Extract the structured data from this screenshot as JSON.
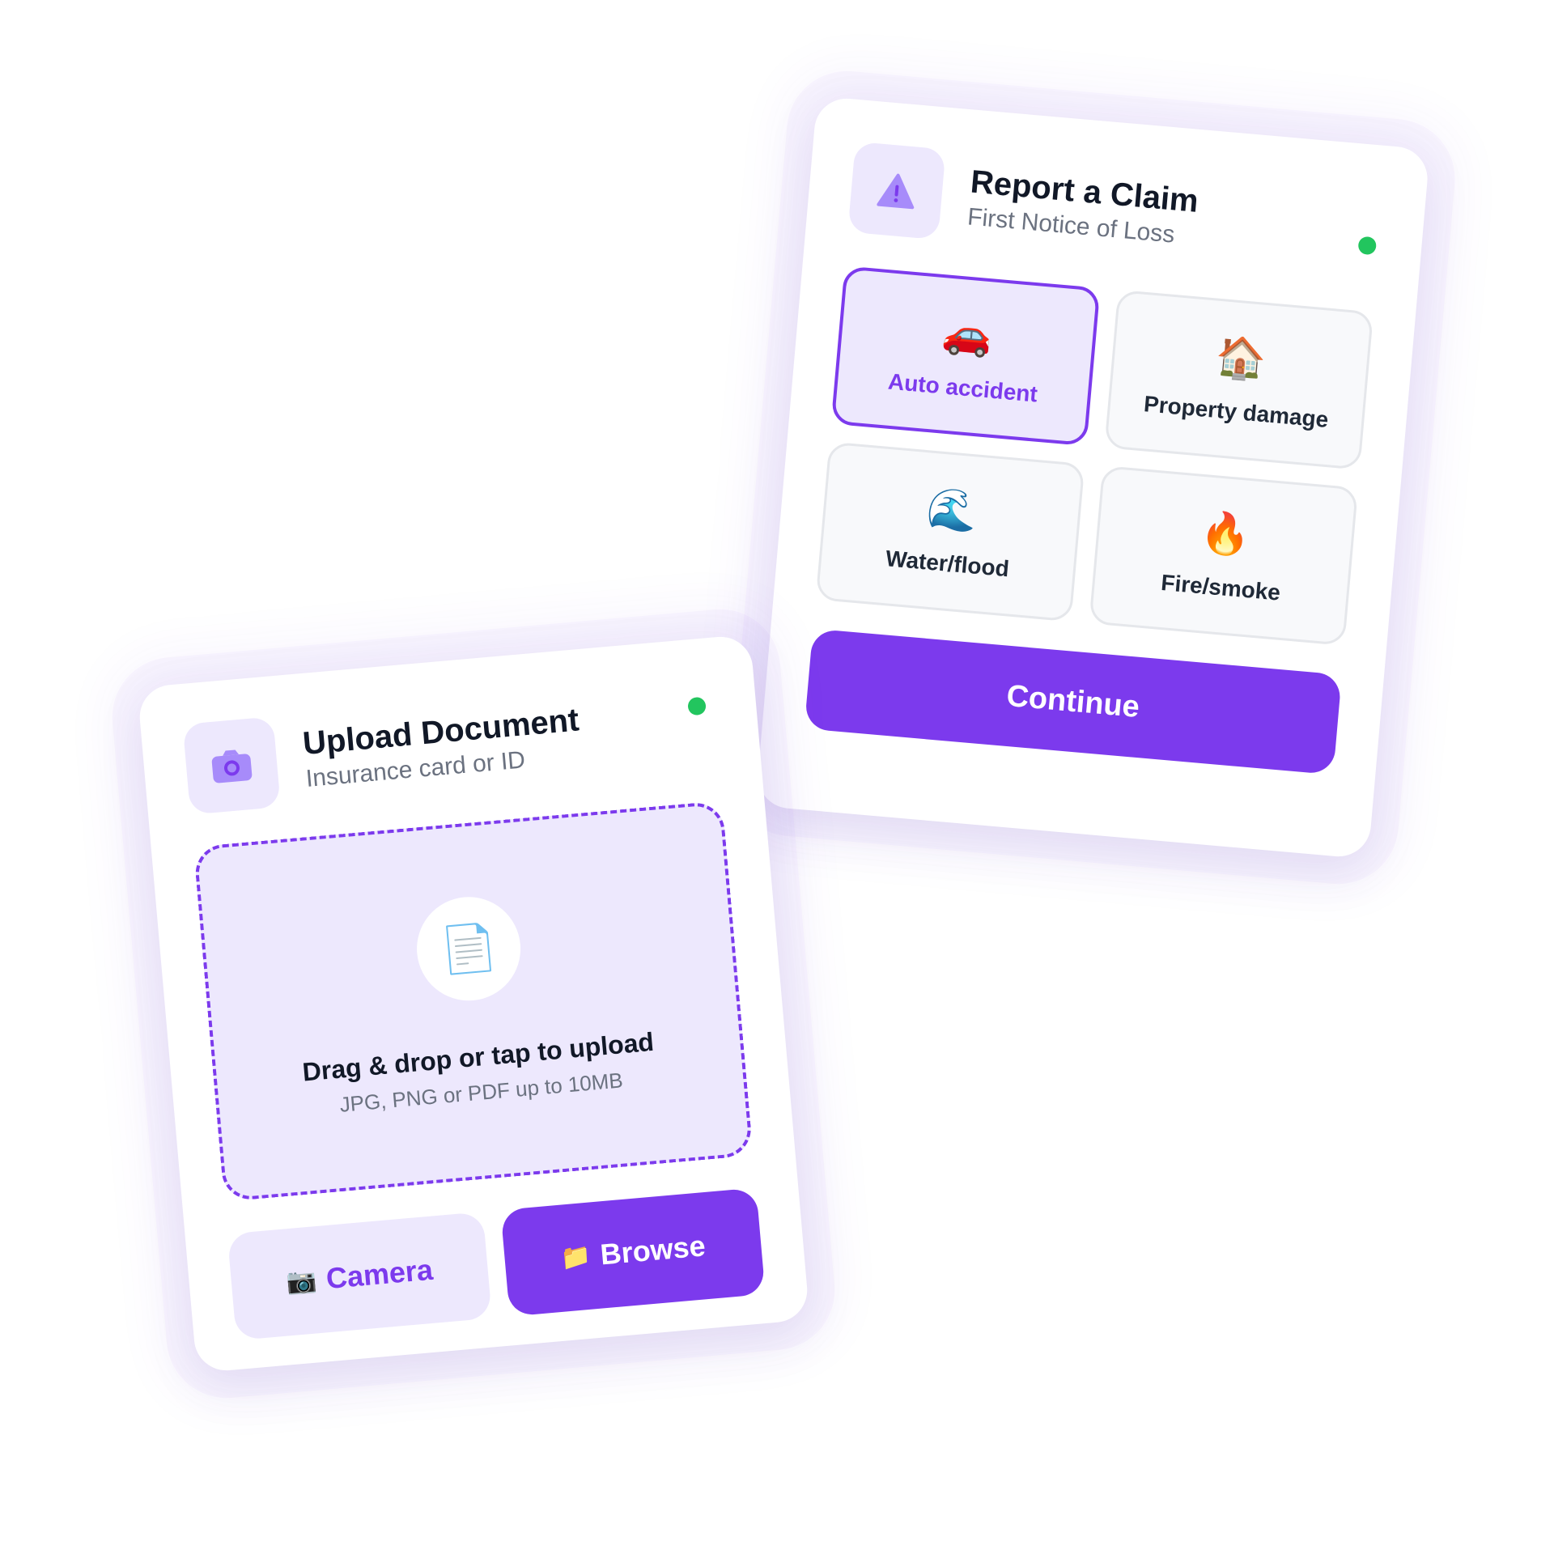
{
  "claim": {
    "title": "Report a Claim",
    "subtitle": "First Notice of Loss",
    "header_icon": "warning-icon",
    "status": "online",
    "options": [
      {
        "label": "Auto accident",
        "emoji": "🚗",
        "icon": "car-icon",
        "selected": true
      },
      {
        "label": "Property damage",
        "emoji": "🏠",
        "icon": "house-icon",
        "selected": false
      },
      {
        "label": "Water/flood",
        "emoji": "🌊",
        "icon": "wave-icon",
        "selected": false
      },
      {
        "label": "Fire/smoke",
        "emoji": "🔥",
        "icon": "fire-icon",
        "selected": false
      }
    ],
    "continue_label": "Continue"
  },
  "upload": {
    "title": "Upload Document",
    "subtitle": "Insurance card or ID",
    "header_icon": "camera-icon",
    "status": "online",
    "dropzone": {
      "icon": "document-icon",
      "emoji": "📄",
      "title": "Drag & drop or tap to upload",
      "hint": "JPG, PNG or PDF up to 10MB"
    },
    "camera_label": "Camera",
    "camera_emoji": "📷",
    "browse_label": "Browse",
    "browse_emoji": "📁"
  },
  "colors": {
    "accent": "#7c3aed",
    "accent_light": "#ede8fd",
    "status_online": "#22c55e",
    "text_primary": "#111827",
    "text_secondary": "#6b7280"
  }
}
